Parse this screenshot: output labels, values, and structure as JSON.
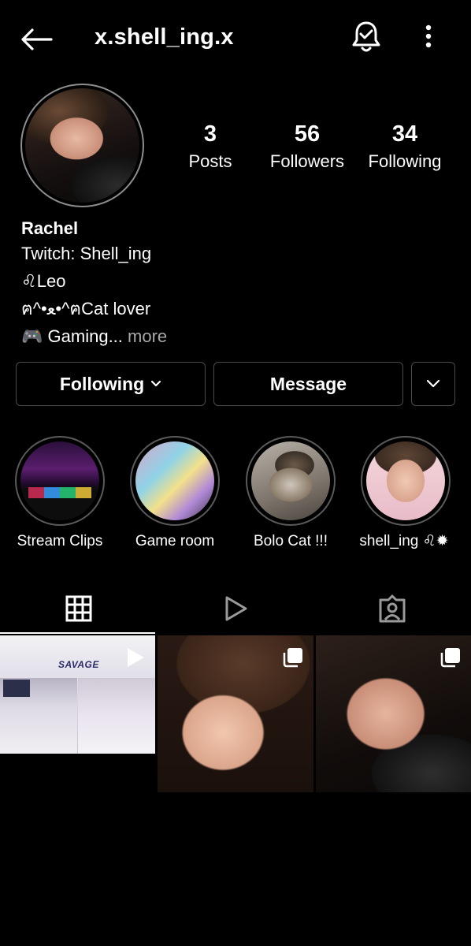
{
  "header": {
    "username": "x.shell_ing.x",
    "back_icon": "arrow-left-icon",
    "bell_icon": "bell-check-icon",
    "more_icon": "more-vertical-icon"
  },
  "stats": {
    "posts": {
      "value": "3",
      "label": "Posts"
    },
    "followers": {
      "value": "56",
      "label": "Followers"
    },
    "following": {
      "value": "34",
      "label": "Following"
    }
  },
  "bio": {
    "name": "Rachel",
    "lines": [
      "Twitch: Shell_ing",
      "♌Leo",
      "ฅ^•ﻌ•^ฅCat lover"
    ],
    "last_line_emoji": "🎮",
    "last_line_text": "Gaming...",
    "more_label": "more"
  },
  "actions": {
    "following_label": "Following",
    "message_label": "Message"
  },
  "highlights": [
    {
      "label": "Stream Clips"
    },
    {
      "label": "Game room"
    },
    {
      "label": "Bolo Cat !!!"
    },
    {
      "label": "shell_ing ♌✹"
    }
  ],
  "tabs": [
    {
      "icon": "grid-icon",
      "active": true
    },
    {
      "icon": "reels-play-icon",
      "active": false
    },
    {
      "icon": "tagged-person-icon",
      "active": false
    }
  ],
  "posts": {
    "post_1_overlay": "SAVAGE"
  },
  "colors": {
    "background": "#000000",
    "text": "#ffffff",
    "muted": "#a8a8a8",
    "button_border": "#4a4a4a"
  }
}
